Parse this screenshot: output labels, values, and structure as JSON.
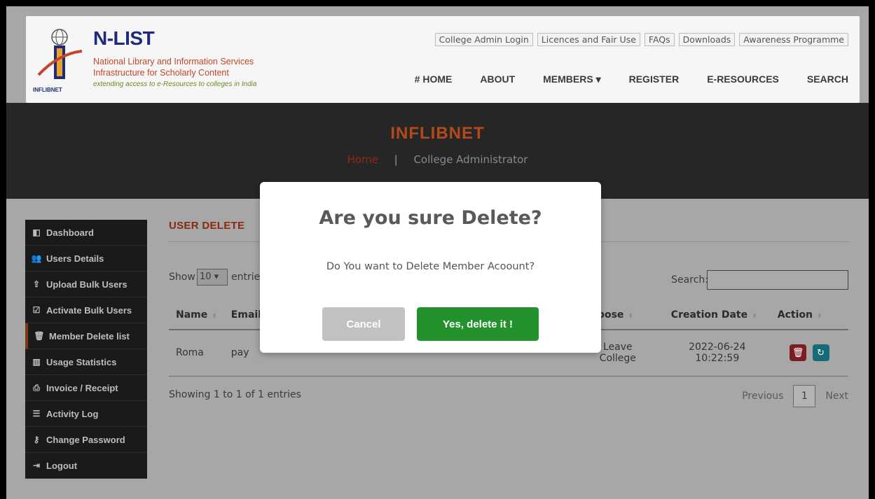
{
  "colors": {
    "overlay_bg": "#a7a7a7",
    "brand_navy": "#1f2a7a",
    "brand_orange": "#c2462a",
    "section_title": "#8a2a0e",
    "confirm_green": "#23922c",
    "cancel_gray": "#c1c1c1",
    "delete_red": "#7a1e22",
    "restore_teal": "#146b7a"
  },
  "logo": {
    "title": "N-LIST",
    "line1": "National Library and Information Services",
    "line2": "Infrastructure for Scholarly Content",
    "tagline": "extending access to e-Resources to colleges in India",
    "emblem_text": "INFLIBNET"
  },
  "toplinks": [
    {
      "label": "College Admin Login"
    },
    {
      "label": "Licences and Fair Use"
    },
    {
      "label": "FAQs"
    },
    {
      "label": "Downloads"
    },
    {
      "label": "Awareness Programme"
    }
  ],
  "nav": {
    "home": "# HOME",
    "about": "ABOUT",
    "members": "MEMBERS ▾",
    "register": "REGISTER",
    "eresources": "E-RESOURCES",
    "search": "SEARCH"
  },
  "banner": {
    "title": "INFLIBNET",
    "crumb_home": "Home",
    "crumb_sep": "|",
    "crumb_current": "College Administrator"
  },
  "sidebar": {
    "items": [
      {
        "label": "Dashboard",
        "icon": "dashboard-icon"
      },
      {
        "label": "Users Details",
        "icon": "users-icon"
      },
      {
        "label": "Upload Bulk Users",
        "icon": "upload-icon"
      },
      {
        "label": "Activate Bulk Users",
        "icon": "checkbox-icon"
      },
      {
        "label": "Member Delete list",
        "icon": "trash-icon"
      },
      {
        "label": "Usage Statistics",
        "icon": "bar-chart-icon"
      },
      {
        "label": "Invoice / Receipt",
        "icon": "print-icon"
      },
      {
        "label": "Activity Log",
        "icon": "list-icon"
      },
      {
        "label": "Change Password",
        "icon": "key-icon"
      },
      {
        "label": "Logout",
        "icon": "logout-icon"
      }
    ]
  },
  "content": {
    "section_title": "USER DELETE",
    "show_label": "Show",
    "show_value": "10",
    "entries_label": "entries",
    "search_label": "Search:",
    "columns": [
      "Name",
      "Email",
      "",
      "",
      "Purpose",
      "Creation Date",
      "Action"
    ],
    "row": {
      "name": "Roma",
      "email": "pay",
      "purpose_line1": "Leave",
      "purpose_line2": "College",
      "date_line1": "2022-06-24",
      "date_line2": "10:22:59"
    },
    "footer_info": "Showing 1 to 1 of 1 entries",
    "pager": {
      "previous": "Previous",
      "current": "1",
      "next": "Next"
    }
  },
  "modal": {
    "title": "Are you sure Delete?",
    "text": "Do You want to Delete Member Acoount?",
    "cancel_label": "Cancel",
    "confirm_label": "Yes, delete it !"
  }
}
